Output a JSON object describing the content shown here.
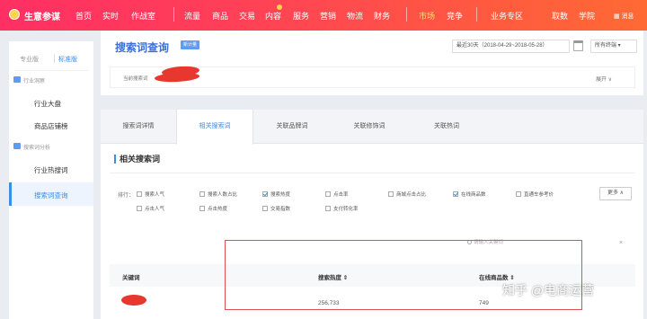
{
  "topbar": {
    "brand": "生意参谋",
    "nav_left": [
      "首页",
      "实时",
      "作战室"
    ],
    "nav_mid": [
      "流量",
      "商品",
      "交易",
      "内容",
      "服务",
      "营销",
      "物流",
      "财务"
    ],
    "nav_active": "市场",
    "nav_compete": "竞争",
    "nav_right": [
      "业务专区",
      "取数",
      "学院"
    ],
    "user": "消息"
  },
  "sidebar": {
    "edition_pro": "专业版",
    "edition_std": "标准版",
    "group_monitor": "行业洞察",
    "item_overview": "行业大盘",
    "item_shop_rank": "商品店铺榜",
    "group_search": "搜索词分析",
    "item_hot": "行业热搜词",
    "item_query": "搜索词查询"
  },
  "header": {
    "title": "搜索词查询",
    "tag": "新计量",
    "date_range": "最近30天（2018-04-29~2018-05-28）",
    "terminal": "所有终端",
    "current_label": "当前搜索词",
    "expand": "展开"
  },
  "tabs": [
    "搜索词详情",
    "相关搜索词",
    "关联品牌词",
    "关联修饰词",
    "关联热词"
  ],
  "section_title": "相关搜索词",
  "filters": {
    "label": "排行：",
    "options": [
      {
        "label": "搜索人气",
        "checked": false
      },
      {
        "label": "搜索人数占比",
        "checked": false
      },
      {
        "label": "搜索热度",
        "checked": true
      },
      {
        "label": "点击率",
        "checked": false
      },
      {
        "label": "商城点击占比",
        "checked": false
      },
      {
        "label": "在线商品数",
        "checked": true
      },
      {
        "label": "直通车参考价",
        "checked": false
      },
      {
        "label": "点击人气",
        "checked": false
      },
      {
        "label": "点击热度",
        "checked": false
      },
      {
        "label": "交易指数",
        "checked": false
      },
      {
        "label": "支付转化率",
        "checked": false
      }
    ],
    "more": "更多"
  },
  "search": {
    "placeholder": "请输入关键词",
    "clear": "×"
  },
  "table": {
    "headers": [
      "关键词",
      "搜索热度 ⇕",
      "在线商品数 ⇕"
    ],
    "rows": [
      {
        "hot": "256,733",
        "goods": "749"
      }
    ]
  },
  "watermark": "知乎 @电商运营",
  "colors": {
    "topbar_start": "#ff2f63",
    "topbar_end": "#ff6a34",
    "accent": "#3a8ee6",
    "highlight": "#e05050"
  }
}
